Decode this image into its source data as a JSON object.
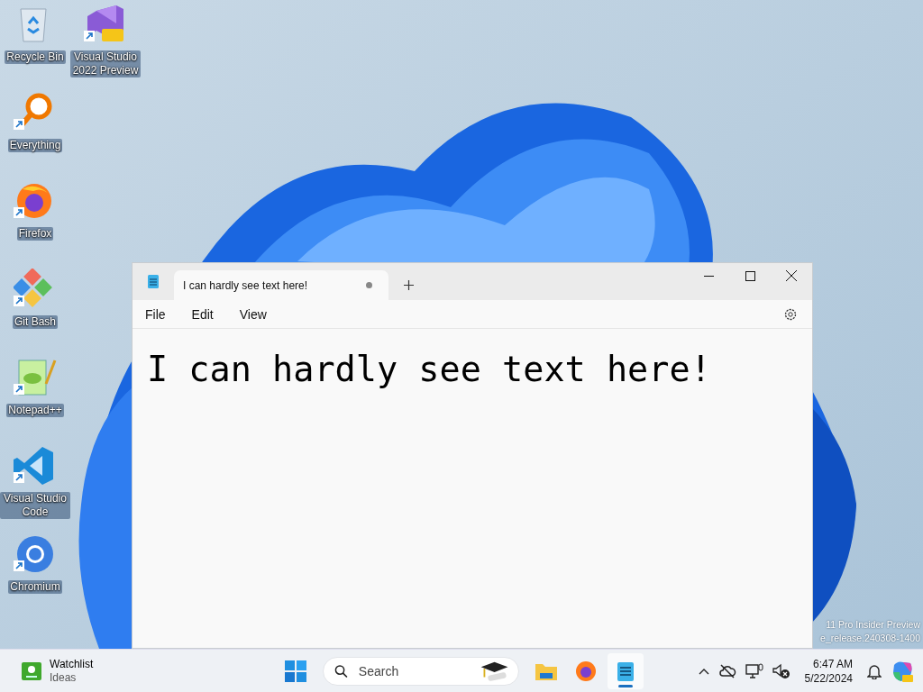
{
  "desktop_icons": [
    {
      "label": "Recycle Bin",
      "kind": "recycle",
      "shortcut": false
    },
    {
      "label": "Visual Studio 2022 Preview",
      "kind": "vs",
      "shortcut": true
    },
    {
      "label": "Everything",
      "kind": "everything",
      "shortcut": true
    },
    {
      "label": "Firefox",
      "kind": "firefox",
      "shortcut": true
    },
    {
      "label": "Git Bash",
      "kind": "git",
      "shortcut": true
    },
    {
      "label": "Notepad++",
      "kind": "notepadpp",
      "shortcut": true
    },
    {
      "label": "Visual Studio Code",
      "kind": "vscode",
      "shortcut": true
    },
    {
      "label": "Chromium",
      "kind": "chromium",
      "shortcut": true
    }
  ],
  "build_info": [
    "11 Pro Insider Preview",
    "e_release.240308-1400"
  ],
  "notepad": {
    "tab": {
      "title": "I can hardly see text here!",
      "modified": true
    },
    "menu": [
      "File",
      "Edit",
      "View"
    ],
    "content": "I can hardly see text here!"
  },
  "taskbar": {
    "widget": {
      "title": "Watchlist",
      "subtitle": "Ideas"
    },
    "search": {
      "placeholder": "Search"
    },
    "apps": [
      {
        "kind": "explorer",
        "selected": false
      },
      {
        "kind": "firefox",
        "selected": false
      },
      {
        "kind": "notepad",
        "selected": true
      }
    ],
    "time": "6:47 AM",
    "date": "5/22/2024"
  }
}
